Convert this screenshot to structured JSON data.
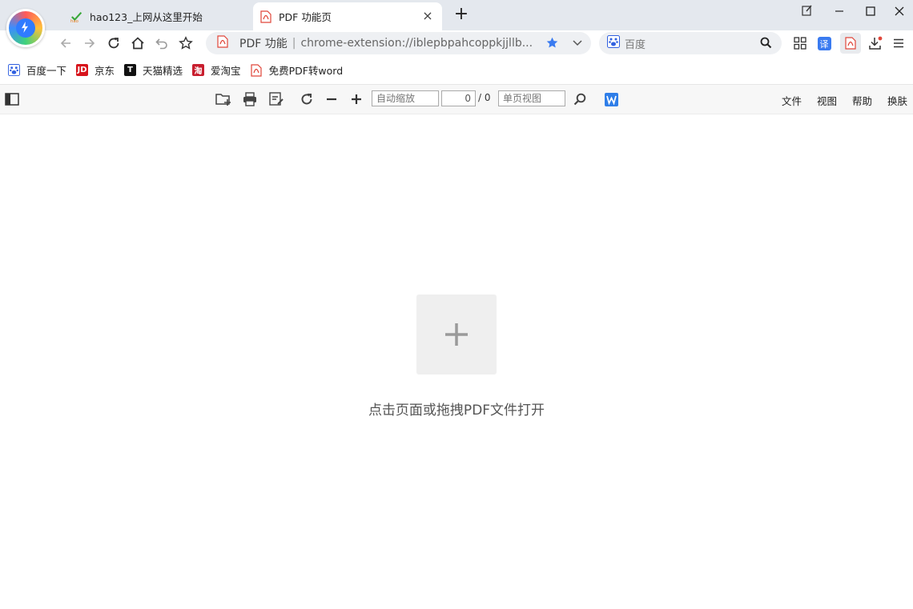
{
  "tabs": [
    {
      "title": "hao123_上网从这里开始",
      "icon": "hao123-icon"
    },
    {
      "title": "PDF 功能页",
      "icon": "pdf-icon",
      "active": true
    }
  ],
  "address_bar": {
    "site_name": "PDF 功能",
    "separator": "|",
    "url": "chrome-extension://iblepbpahcoppkjjllb..."
  },
  "search_box": {
    "placeholder": "百度"
  },
  "bookmarks": [
    {
      "label": "百度一下",
      "icon": "baidu-paw-icon"
    },
    {
      "label": "京东",
      "icon": "jd-icon",
      "icon_text": "JD"
    },
    {
      "label": "天猫精选",
      "icon": "tmall-icon",
      "icon_text": "T"
    },
    {
      "label": "爱淘宝",
      "icon": "taobao-icon",
      "icon_text": "淘"
    },
    {
      "label": "免费PDF转word",
      "icon": "pdf-icon"
    }
  ],
  "pdf_toolbar": {
    "zoom_placeholder": "自动缩放",
    "page_value": "0",
    "page_total": "/ 0",
    "view_mode_placeholder": "单页视图",
    "menus": [
      "文件",
      "视图",
      "帮助",
      "换肤"
    ]
  },
  "main": {
    "hint": "点击页面或拖拽PDF文件打开"
  },
  "colors": {
    "tabstrip_bg": "#e4e8ee",
    "accent_blue": "#3a7bf0",
    "pdf_red": "#e0463a"
  }
}
